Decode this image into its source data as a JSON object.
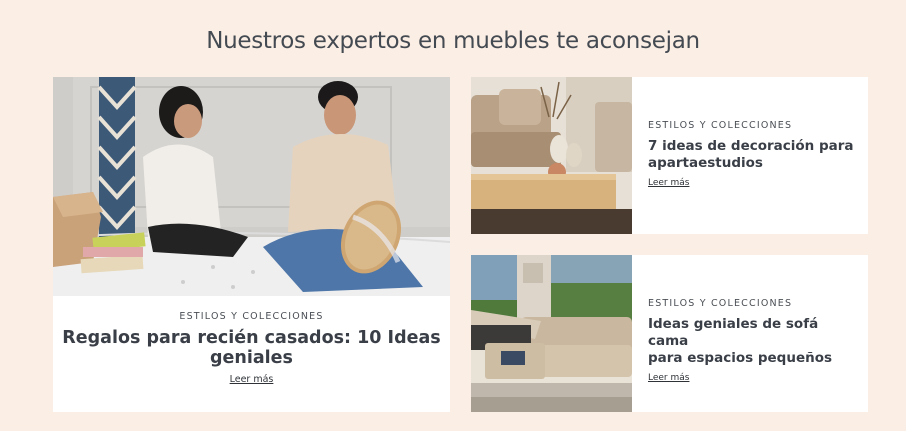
{
  "section": {
    "title": "Nuestros expertos en muebles  te aconsejan"
  },
  "cards": [
    {
      "category": "ESTILOS Y COLECCIONES",
      "title": "Regalos para recién casados: 10 Ideas geniales",
      "link": "Leer más"
    },
    {
      "category": "ESTILOS Y COLECCIONES",
      "title_lines": [
        "7 ideas de decoración para",
        "apartaestudios"
      ],
      "link": "Leer más"
    },
    {
      "category": "ESTILOS Y COLECCIONES",
      "title_lines": [
        "Ideas geniales de sofá cama",
        "para espacios pequeños"
      ],
      "link": "Leer más"
    }
  ]
}
